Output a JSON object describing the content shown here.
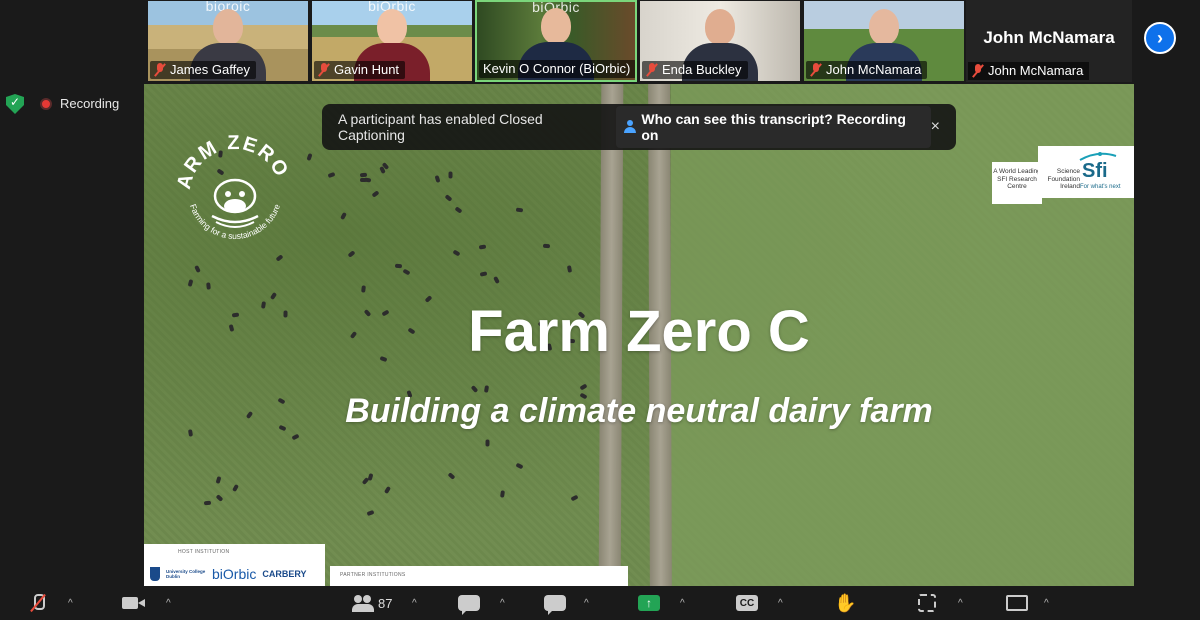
{
  "participants": [
    {
      "name": "James Gaffey",
      "brand": "bioroic",
      "muted": true
    },
    {
      "name": "Gavin Hunt",
      "brand": "biOrbic",
      "muted": true
    },
    {
      "name": "Kevin O Connor (BiOrbic)",
      "brand": "biOrbic",
      "muted": false,
      "active": true
    },
    {
      "name": "Enda Buckley",
      "brand": "",
      "muted": true
    },
    {
      "name": "John McNamara",
      "brand": "",
      "muted": true
    },
    {
      "name": "John McNamara",
      "brand": "",
      "muted": true
    }
  ],
  "featured_name": "John McNamara",
  "status": {
    "recording_label": "Recording"
  },
  "notice": {
    "text": "A participant has enabled Closed Captioning",
    "link": "Who can see this transcript? Recording on",
    "close": "×"
  },
  "slide": {
    "title": "Farm Zero C",
    "subtitle": "Building a climate neutral dairy farm",
    "logo_name": "FARM ZERO C",
    "logo_tagline": "Farming for a sustainable future",
    "sfi_left": "A World Leading SFI Research Centre",
    "sfi_org": "Science Foundation Ireland",
    "sfi_mark": "Sfi",
    "sfi_tag": "For what's next",
    "host_caption": "HOST INSTITUTION",
    "host_logos": [
      "University College Dublin",
      "biOrbic",
      "CARBERY"
    ],
    "partner_caption": "PARTNER INSTITUTIONS"
  },
  "toolbar": {
    "participants_count": "87",
    "next": "›",
    "caret": "^",
    "share_glyph": "↑",
    "cc_label": "CC",
    "hand_glyph": "✋"
  },
  "colors": {
    "accent": "#0e71eb",
    "share_green": "#23a455",
    "record_red": "#e53935"
  }
}
